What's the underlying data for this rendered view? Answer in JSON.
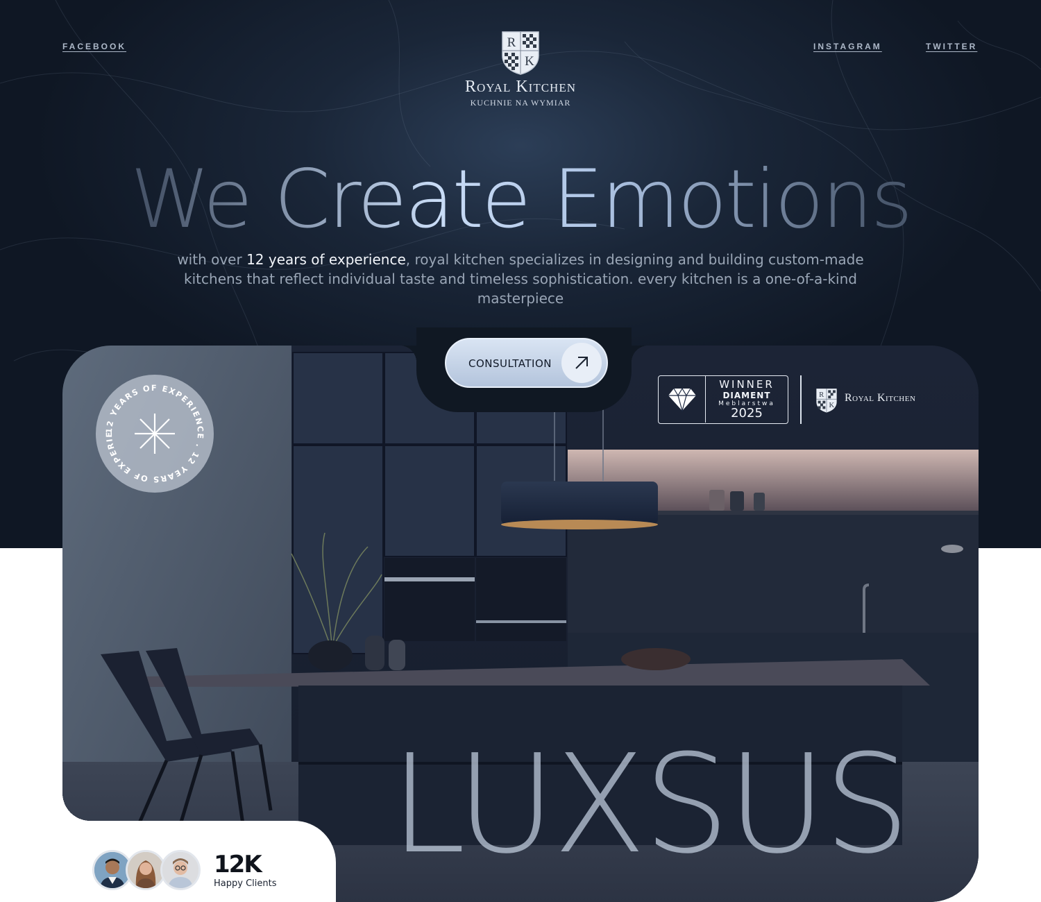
{
  "nav": {
    "facebook": "FACEBOOK",
    "instagram": "INSTAGRAM",
    "twitter": "TWITTER"
  },
  "logo": {
    "brand": "Royal Kitchen",
    "tagline": "KUCHNIE NA WYMIAR",
    "crest_letters": [
      "R",
      "K"
    ]
  },
  "hero": {
    "headline": "We Create Emotions",
    "intro_before": "with over ",
    "intro_highlight": "12 years of experience",
    "intro_after": ", royal kitchen specializes in designing and building custom-made kitchens that reflect individual taste and timeless sophistication. every kitchen is a one-of-a-kind masterpiece"
  },
  "cta": {
    "label": "CONSULTATION",
    "icon": "arrow-up-right-icon"
  },
  "badge": {
    "ring_text": "12 YEARS OF EXPERIENCE . 12 YEARS OF EXPERIENCE . ",
    "icon": "asterisk-icon"
  },
  "award": {
    "winner": "WINNER",
    "diament": "DIAMENT",
    "meblarstwa": "Meblarstwa",
    "year": "2025",
    "brand": "Royal Kitchen"
  },
  "feature_word": "LUXSUS",
  "clients": {
    "count": "12K",
    "label": "Happy Clients"
  },
  "colors": {
    "hero_bg": "#121b29",
    "accent_light": "#c9dcf6",
    "card_bg": "#1f2a3d"
  }
}
